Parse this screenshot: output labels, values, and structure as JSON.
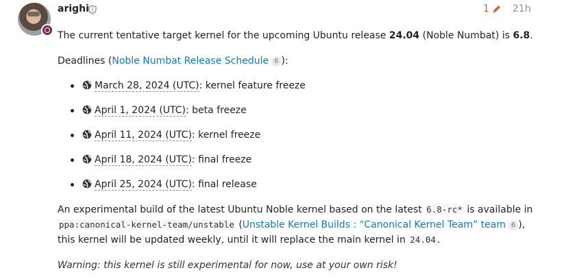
{
  "post": {
    "author": "arighi",
    "edit_count": "1",
    "age": "21h",
    "p1": {
      "before": "The current tentative target kernel for the upcoming Ubuntu release ",
      "version": "24.04",
      "middle": " (Noble Numbat) is ",
      "kernel": "6.8",
      "after": "."
    },
    "p2": {
      "before": "Deadlines (",
      "link": "Noble Numbat Release Schedule",
      "link_count": "6",
      "after": "):"
    },
    "deadlines": [
      {
        "date": "March 28, 2024 (UTC)",
        "label": ": kernel feature freeze"
      },
      {
        "date": "April 1, 2024 (UTC)",
        "label": ": beta freeze"
      },
      {
        "date": "April 11, 2024 (UTC)",
        "label": ": kernel freeze"
      },
      {
        "date": "April 18, 2024 (UTC)",
        "label": ": final freeze"
      },
      {
        "date": "April 25, 2024 (UTC)",
        "label": ": final release"
      }
    ],
    "p3": {
      "t1": "An experimental build of the latest Ubuntu Noble kernel based on the latest ",
      "code1": "6.8-rc*",
      "t2": " is available in",
      "code2": "ppa:canonical-kernel-team/unstable",
      "t3": " (",
      "link": "Unstable Kernel Builds : “Canonical Kernel Team” team",
      "link_count": "6",
      "t4": "),",
      "t5": "this kernel will be updated weekly, until it will replace the main kernel in ",
      "code3": "24.04",
      "t6": "."
    },
    "warning": "Warning: this kernel is still experimental for now, use at your own risk!"
  },
  "colors": {
    "link": "#0a7aca",
    "edit": "#e45735",
    "flair": "#772953",
    "muted": "#919191"
  },
  "icons": {
    "globe": "globe-icon",
    "pencil": "pencil-icon",
    "shield": "shield-icon"
  }
}
